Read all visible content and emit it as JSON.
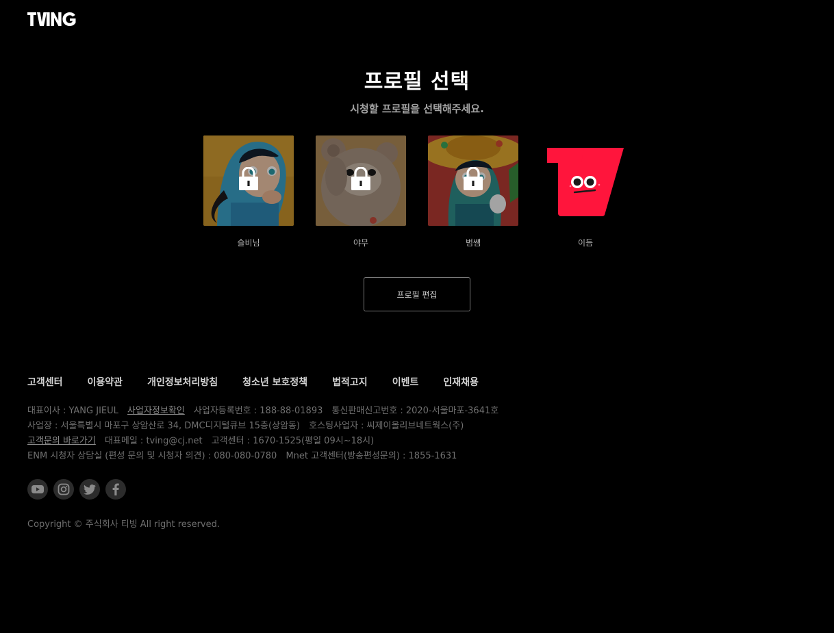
{
  "brand": {
    "logo_text": "TVING",
    "accent": "#ff153c"
  },
  "page": {
    "title": "프로필 선택",
    "subtitle": "시청할 프로필을 선택해주세요."
  },
  "profiles": [
    {
      "name": "슬비님",
      "locked": true,
      "avatar": "hooded-character-avatar"
    },
    {
      "name": "야무",
      "locked": true,
      "avatar": "bear-avatar"
    },
    {
      "name": "범쌤",
      "locked": true,
      "avatar": "sombrero-character-avatar"
    },
    {
      "name": "이듬",
      "locked": false,
      "avatar": "tving-red-t-mascot"
    }
  ],
  "edit_button": "프로필 편집",
  "footer": {
    "links": [
      "고객센터",
      "이용약관",
      "개인정보처리방침",
      "청소년 보호정책",
      "법적고지",
      "이벤트",
      "인재채용"
    ],
    "line1": {
      "ceo": "대표이사 : YANG JIEUL",
      "biz_info_link": "사업자정보확인",
      "biz_no": "사업자등록번호 : 188-88-01893",
      "mail_order": "통신판매신고번호 : 2020-서울마포-3641호"
    },
    "line2": {
      "address": "사업장 : 서울특별시 마포구 상암산로 34, DMC디지털큐브 15층(상암동)",
      "hosting": "호스팅사업자 : 씨제이올리브네트웍스(주)"
    },
    "line3": {
      "inquiry_link": "고객문의 바로가기",
      "email": "대표메일 : tving@cj.net",
      "cs": "고객센터 : 1670-1525(평일 09시~18시)"
    },
    "line4": {
      "enm": "ENM 시청자 상담실 (편성 문의 및 시청자 의견) : 080-080-0780",
      "mnet": "Mnet 고객센터(방송편성문의) : 1855-1631"
    },
    "social": [
      "youtube-icon",
      "instagram-icon",
      "twitter-icon",
      "facebook-icon"
    ],
    "copyright": "Copyright © 주식회사 티빙 All right reserved."
  }
}
